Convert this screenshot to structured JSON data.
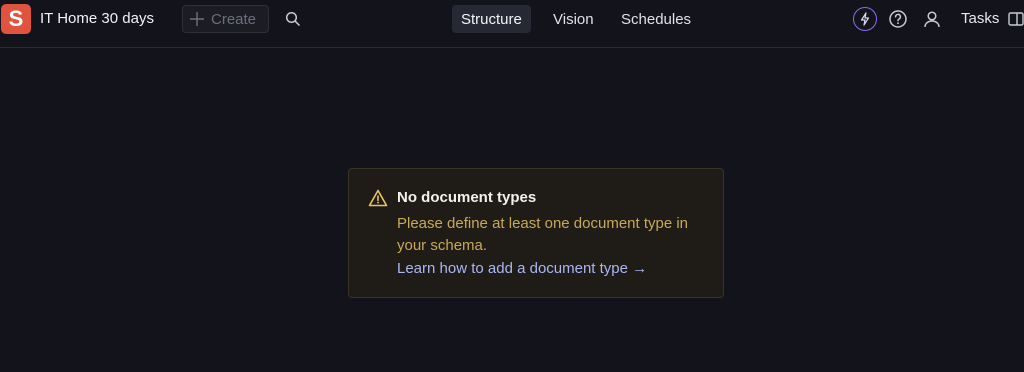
{
  "header": {
    "logo_letter": "S",
    "project_title": "IT Home 30 days",
    "create_label": "Create",
    "tabs": [
      {
        "label": "Structure",
        "active": true
      },
      {
        "label": "Vision",
        "active": false
      },
      {
        "label": "Schedules",
        "active": false
      }
    ],
    "tasks_label": "Tasks",
    "icons": {
      "create": "plus-icon",
      "search": "search-icon",
      "ai": "lightning-icon",
      "help": "help-icon",
      "profile": "user-icon",
      "panel": "sidebar-panel-icon"
    }
  },
  "callout": {
    "icon": "warning-icon",
    "title": "No document types",
    "body": "Please define at least one document type in your schema.",
    "link": "Learn how to add a document type →"
  },
  "colors": {
    "background": "#13141b",
    "logo_bg": "#e0533f",
    "accent_purple": "#8a6cf0",
    "warning_bg": "#1f1c17",
    "warning_text": "#c9a857",
    "link": "#a9b6f2"
  }
}
